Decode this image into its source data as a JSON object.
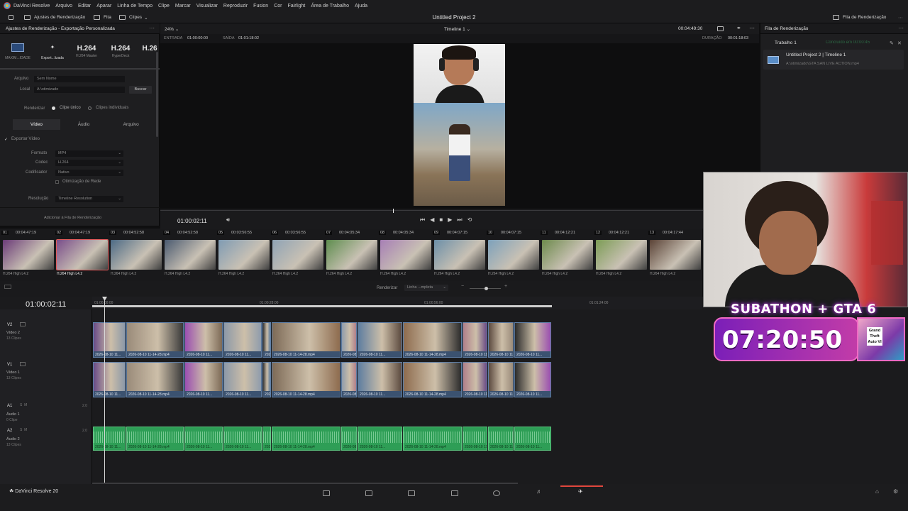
{
  "menu": [
    "DaVinci Resolve",
    "Arquivo",
    "Editar",
    "Aparar",
    "Linha de Tempo",
    "Clipe",
    "Marcar",
    "Visualizar",
    "Reproduzir",
    "Fusion",
    "Cor",
    "Fairlight",
    "Área de Trabalho",
    "Ajuda"
  ],
  "toolbar": {
    "render_settings": "Ajustes de Renderização",
    "tape": "Fita",
    "clips": "Clipes",
    "project_title": "Untitled Project 2",
    "render_queue_btn": "Fila de Renderização"
  },
  "left_panel": {
    "header": "Ajustes de Renderização - Exportação Personalizada",
    "presets": [
      {
        "big": "",
        "sm": "MAXIM...IDADE"
      },
      {
        "big": "",
        "sm": "Export...lizada"
      },
      {
        "big": "H.264",
        "sm": "H.264 Master"
      },
      {
        "big": "H.264",
        "sm": "HyperDeck"
      },
      {
        "big": "H.26",
        "sm": ""
      }
    ],
    "file_label": "Arquivo",
    "file_value": "Sem Nome",
    "location_label": "Local",
    "location_value": "A:\\otimizado",
    "browse": "Buscar",
    "render_label": "Renderizar",
    "single_clip": "Clipe único",
    "individual_clips": "Clipes individuais",
    "tabs": [
      "Vídeo",
      "Áudio",
      "Arquivo"
    ],
    "export_video": "Exportar Vídeo",
    "format_label": "Formato",
    "format_value": "MP4",
    "codec_label": "Codec",
    "codec_value": "H.264",
    "encoder_label": "Codificador",
    "encoder_value": "Nativo",
    "network_opt": "Otimização de Rede",
    "resolution_label": "Resolução",
    "resolution_value": "Timeline Resolution",
    "add_queue": "Adicionar à Fila de Renderização"
  },
  "viewer": {
    "zoom": "24%",
    "timeline_name": "Timeline 1",
    "timecode_total": "00:04:49:30",
    "in_label": "ENTRADA",
    "in_value": "01:00:00:00",
    "out_label": "SAÍDA",
    "out_value": "01:01:18:02",
    "duration_label": "DURAÇÃO",
    "duration_value": "00:01:18:03",
    "current_tc": "01:00:02:11"
  },
  "render_queue": {
    "header": "Fila de Renderização",
    "job_title": "Trabalho 1",
    "job_status": "Concluído em 00:00:45",
    "job_name": "Untitled Project 2 | Timeline 1",
    "job_path": "A:\\otimizado\\GTA SAN LIVE ACTION.mp4"
  },
  "clip_row": {
    "items": [
      {
        "num": "01",
        "tc": "00:04:47:19",
        "codec": "H.264 High L4.2"
      },
      {
        "num": "02",
        "tc": "00:04:47:19",
        "codec": "H.264 High L4.2"
      },
      {
        "num": "03",
        "tc": "00:04:52:58",
        "codec": "H.264 High L4.2"
      },
      {
        "num": "04",
        "tc": "00:04:52:58",
        "codec": "H.264 High L4.2"
      },
      {
        "num": "05",
        "tc": "00:03:56:55",
        "codec": "H.264 High L4.2"
      },
      {
        "num": "06",
        "tc": "00:03:56:55",
        "codec": "H.264 High L4.2"
      },
      {
        "num": "07",
        "tc": "00:04:05:34",
        "codec": "H.264 High L4.2"
      },
      {
        "num": "08",
        "tc": "00:04:05:34",
        "codec": "H.264 High L4.2"
      },
      {
        "num": "09",
        "tc": "00:04:07:15",
        "codec": "H.264 High L4.2"
      },
      {
        "num": "10",
        "tc": "00:04:07:15",
        "codec": "H.264 High L4.2"
      },
      {
        "num": "11",
        "tc": "00:04:12:21",
        "codec": "H.264 High L4.2"
      },
      {
        "num": "12",
        "tc": "00:04:12:21",
        "codec": "H.264 High L4.2"
      },
      {
        "num": "13",
        "tc": "00:04:17:44",
        "codec": "H.264 High L4.2"
      }
    ]
  },
  "timeline": {
    "render_label": "Renderizar",
    "render_mode": "Linha ...mpleta",
    "timecode": "01:00:02:11",
    "ruler": [
      "01:00:00:00",
      "01:00:28:00",
      "01:00:56:00",
      "01:01:24:00"
    ],
    "tracks": [
      {
        "id": "V2",
        "name": "Vídeo 2",
        "count": "13 Clipes"
      },
      {
        "id": "V1",
        "name": "Vídeo 1",
        "count": "13 Clipes"
      },
      {
        "id": "A1",
        "name": "Áudio 1",
        "count": "0 Clipe",
        "level": "2.0"
      },
      {
        "id": "A2",
        "name": "Áudio 2",
        "count": "13 Clipes",
        "level": "2.0"
      }
    ],
    "clip_caption": "2026-08-10 11-14-28.mp4",
    "clip_caption_short": "2026-08-10 11..."
  },
  "bottom": {
    "app": "DaVinci Resolve 20"
  },
  "overlay": {
    "subathon_title": "SUBATHON + GTA 6",
    "timer": "07:20:50",
    "cover_text": "Grand Theft Auto VI"
  }
}
